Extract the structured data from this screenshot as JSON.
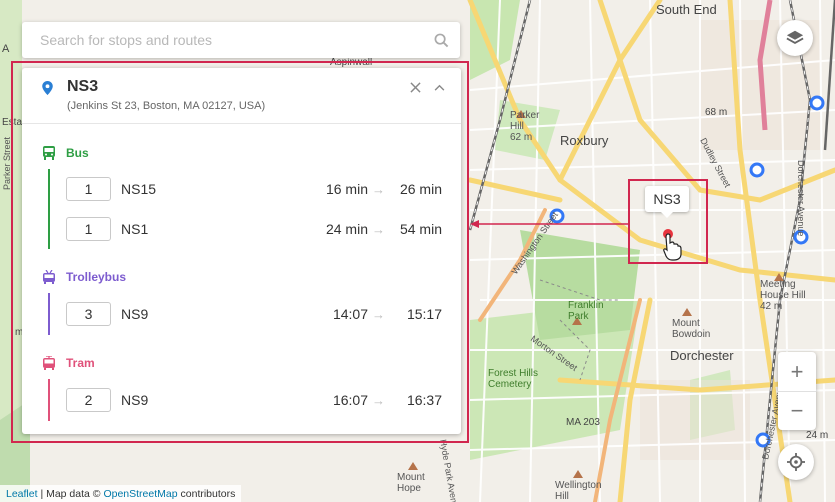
{
  "search": {
    "placeholder": "Search for stops and routes"
  },
  "stop": {
    "name": "NS3",
    "address": "(Jenkins St 23, Boston, MA 02127, USA)",
    "marker_label": "NS3"
  },
  "sections": [
    {
      "mode": "Bus",
      "icon": "bus-icon",
      "color": "#2e9e44",
      "routes": [
        {
          "number": "1",
          "name": "NS15",
          "time_a": "16 min",
          "time_b": "26 min"
        },
        {
          "number": "1",
          "name": "NS1",
          "time_a": "24 min",
          "time_b": "54 min"
        }
      ]
    },
    {
      "mode": "Trolleybus",
      "icon": "trolleybus-icon",
      "color": "#7d5ccf",
      "routes": [
        {
          "number": "3",
          "name": "NS9",
          "time_a": "14:07",
          "time_b": "15:17"
        }
      ]
    },
    {
      "mode": "Tram",
      "icon": "tram-icon",
      "color": "#e0517a",
      "routes": [
        {
          "number": "2",
          "name": "NS9",
          "time_a": "16:07",
          "time_b": "16:37"
        }
      ]
    }
  ],
  "map_labels": {
    "south_end": "South End",
    "roxbury": "Roxbury",
    "parker_hill": "Parker\nHill\n62 m",
    "franklin_park": "Franklin\nPark",
    "forest_hills_cemetery": "Forest Hills\nCemetery",
    "mount_bowdoin": "Mount\nBowdoin",
    "dorchester": "Dorchester",
    "meeting_house_hill": "Meeting\nHouse Hill\n42 m",
    "mount_hope": "Mount\nHope",
    "wellington_hill": "Wellington\nHill",
    "ma_203": "MA 203",
    "dudley_street": "Dudley Street",
    "washington_street": "Washington Street",
    "morton_street": "Morton Street",
    "dorchester_avenue": "Dorchester Avenue",
    "parker_street": "Parker Street",
    "hyde_park_avenue": "Hyde Park Avenue",
    "a_label": "A",
    "estate": "Estate",
    "aspinwall": "Aspinwall",
    "m_label": "m",
    "elevation_68": "68 m",
    "elevation_24": "24 m"
  },
  "controls": {
    "zoom_in": "+",
    "zoom_out": "−"
  },
  "attribution": {
    "leaflet": "Leaflet",
    "separator": " | Map data © ",
    "osm": "OpenStreetMap",
    "suffix": " contributors"
  },
  "colors": {
    "highlight": "#d1274f",
    "map_bg": "#f2efe9",
    "park": "#c8e6b0",
    "road_major": "#f9d87a",
    "pin": "#2a7fd4"
  }
}
